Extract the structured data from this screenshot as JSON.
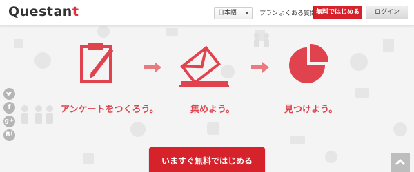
{
  "header": {
    "logo": {
      "text": "Questan",
      "accent": "t"
    },
    "language": {
      "selected": "日本語"
    },
    "nav": {
      "plan": "プラン",
      "faq": "よくある質問"
    },
    "start_button": "無料ではじめる",
    "login_button": "ログイン"
  },
  "steps": [
    {
      "label": "アンケートをつくろう。",
      "icon": "pencil-clipboard-icon"
    },
    {
      "label": "集めよう。",
      "icon": "envelope-tray-icon"
    },
    {
      "label": "見つけよう。",
      "icon": "pie-chart-icon"
    }
  ],
  "social": {
    "twitter": "",
    "facebook": "f",
    "googleplus": "g+",
    "hatena": "B!"
  },
  "cta": {
    "label": "いますぐ無料ではじめる"
  },
  "colors": {
    "accent": "#d6232b",
    "icon": "#e0434d",
    "background": "#f4f4f4"
  }
}
